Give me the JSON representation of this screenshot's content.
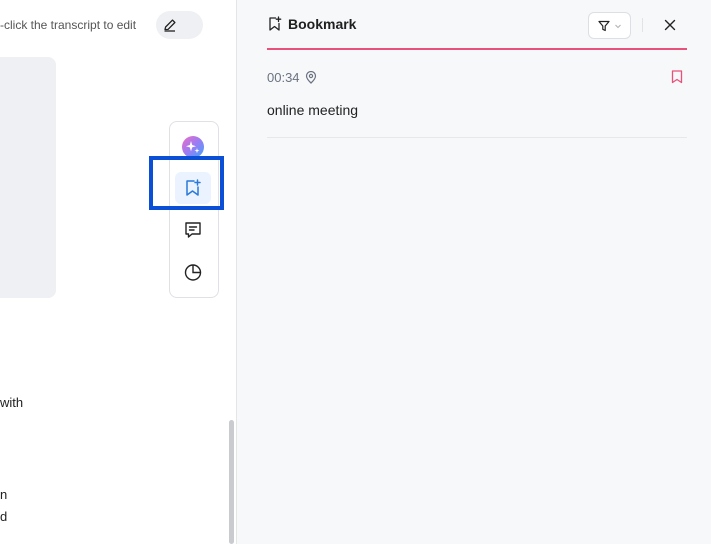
{
  "transcript": {
    "hint": "-click the transcript to edit",
    "fragments": [
      "with",
      "n",
      "d"
    ]
  },
  "toolbar": {
    "tools": [
      {
        "icon": "ai-assistant-icon"
      },
      {
        "icon": "bookmark-add-icon",
        "active": true
      },
      {
        "icon": "comment-icon"
      },
      {
        "icon": "pie-chart-icon"
      }
    ]
  },
  "bookmark_panel": {
    "title": "Bookmark",
    "accent_color": "#e8527a",
    "entries": [
      {
        "time": "00:34",
        "text": "online meeting"
      }
    ]
  }
}
